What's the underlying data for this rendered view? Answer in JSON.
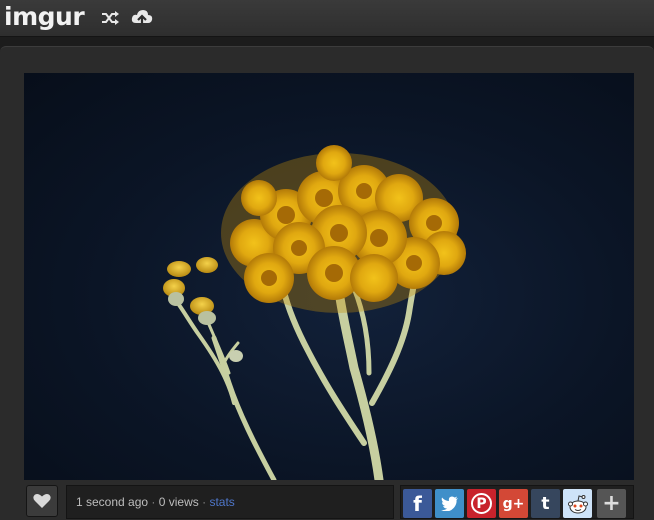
{
  "header": {
    "logo_text": "imgur",
    "brand_green": "#85bf25",
    "icons": [
      "shuffle-icon",
      "upload-cloud-icon"
    ]
  },
  "image": {
    "subject": "yellow-flower-cluster-photo"
  },
  "footer": {
    "like_icon": "heart-icon",
    "time_text": "1 second ago",
    "separator": "·",
    "views_text": "0 views",
    "stats_link": "stats",
    "share": {
      "facebook": "f",
      "twitter": "t",
      "pinterest": "P",
      "google": "g+",
      "tumblr": "t",
      "reddit": "reddit-icon",
      "more": "+"
    },
    "colors": {
      "facebook": "#3b5998",
      "twitter": "#3f8fc9",
      "pinterest": "#c8232c",
      "google": "#d34836",
      "tumblr": "#36465d",
      "reddit": "#cee3f8",
      "more": "#555555",
      "stats": "#4e76c9"
    }
  }
}
